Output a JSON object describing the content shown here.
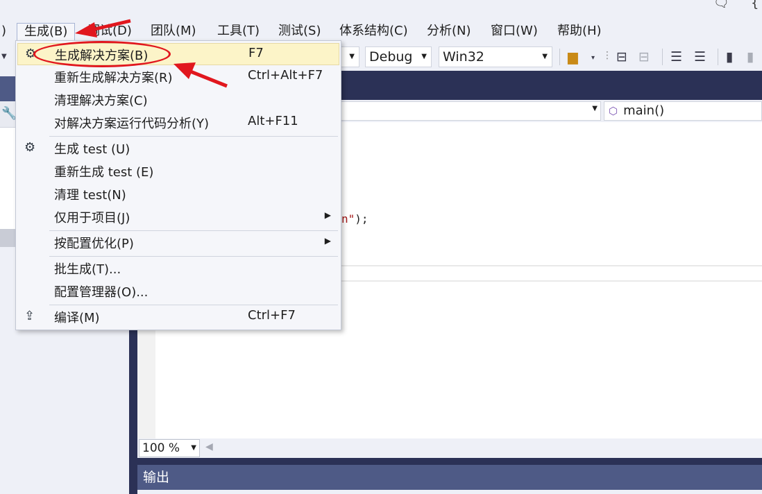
{
  "top_right": {
    "icon1": "chat-icon",
    "icon2": "partial-icon"
  },
  "menubar": {
    "items": [
      {
        "label": ")"
      },
      {
        "label": "生成(B)"
      },
      {
        "label": "调试(D)"
      },
      {
        "label": "团队(M)"
      },
      {
        "label": "工具(T)"
      },
      {
        "label": "测试(S)"
      },
      {
        "label": "体系结构(C)"
      },
      {
        "label": "分析(N)"
      },
      {
        "label": "窗口(W)"
      },
      {
        "label": "帮助(H)"
      }
    ]
  },
  "toolbar": {
    "config": "Debug",
    "platform": "Win32"
  },
  "navbar": {
    "function": "main()"
  },
  "code": {
    "fragment_str": "n\"",
    "fragment_end": ");"
  },
  "zoom": {
    "value": "100 %"
  },
  "output": {
    "title": "输出"
  },
  "build_menu": {
    "items": [
      {
        "label": "生成解决方案(B)",
        "shortcut": "F7",
        "icon": "build-icon",
        "highlighted": true
      },
      {
        "label": "重新生成解决方案(R)",
        "shortcut": "Ctrl+Alt+F7"
      },
      {
        "label": "清理解决方案(C)",
        "shortcut": ""
      },
      {
        "label": "对解决方案运行代码分析(Y)",
        "shortcut": "Alt+F11"
      },
      {
        "label": "生成 test (U)",
        "shortcut": "",
        "icon": "build-icon"
      },
      {
        "label": "重新生成 test (E)",
        "shortcut": ""
      },
      {
        "label": "清理 test(N)",
        "shortcut": ""
      },
      {
        "label": "仅用于项目(J)",
        "shortcut": "",
        "submenu": true
      },
      {
        "label": "按配置优化(P)",
        "shortcut": "",
        "submenu": true
      },
      {
        "label": "批生成(T)...",
        "shortcut": ""
      },
      {
        "label": "配置管理器(O)...",
        "shortcut": ""
      },
      {
        "label": "编译(M)",
        "shortcut": "Ctrl+F7",
        "icon": "compile-icon"
      }
    ]
  },
  "colors": {
    "highlight": "#fcf4c8",
    "annotation": "#e1171e",
    "panel_header": "#4e5a86"
  }
}
